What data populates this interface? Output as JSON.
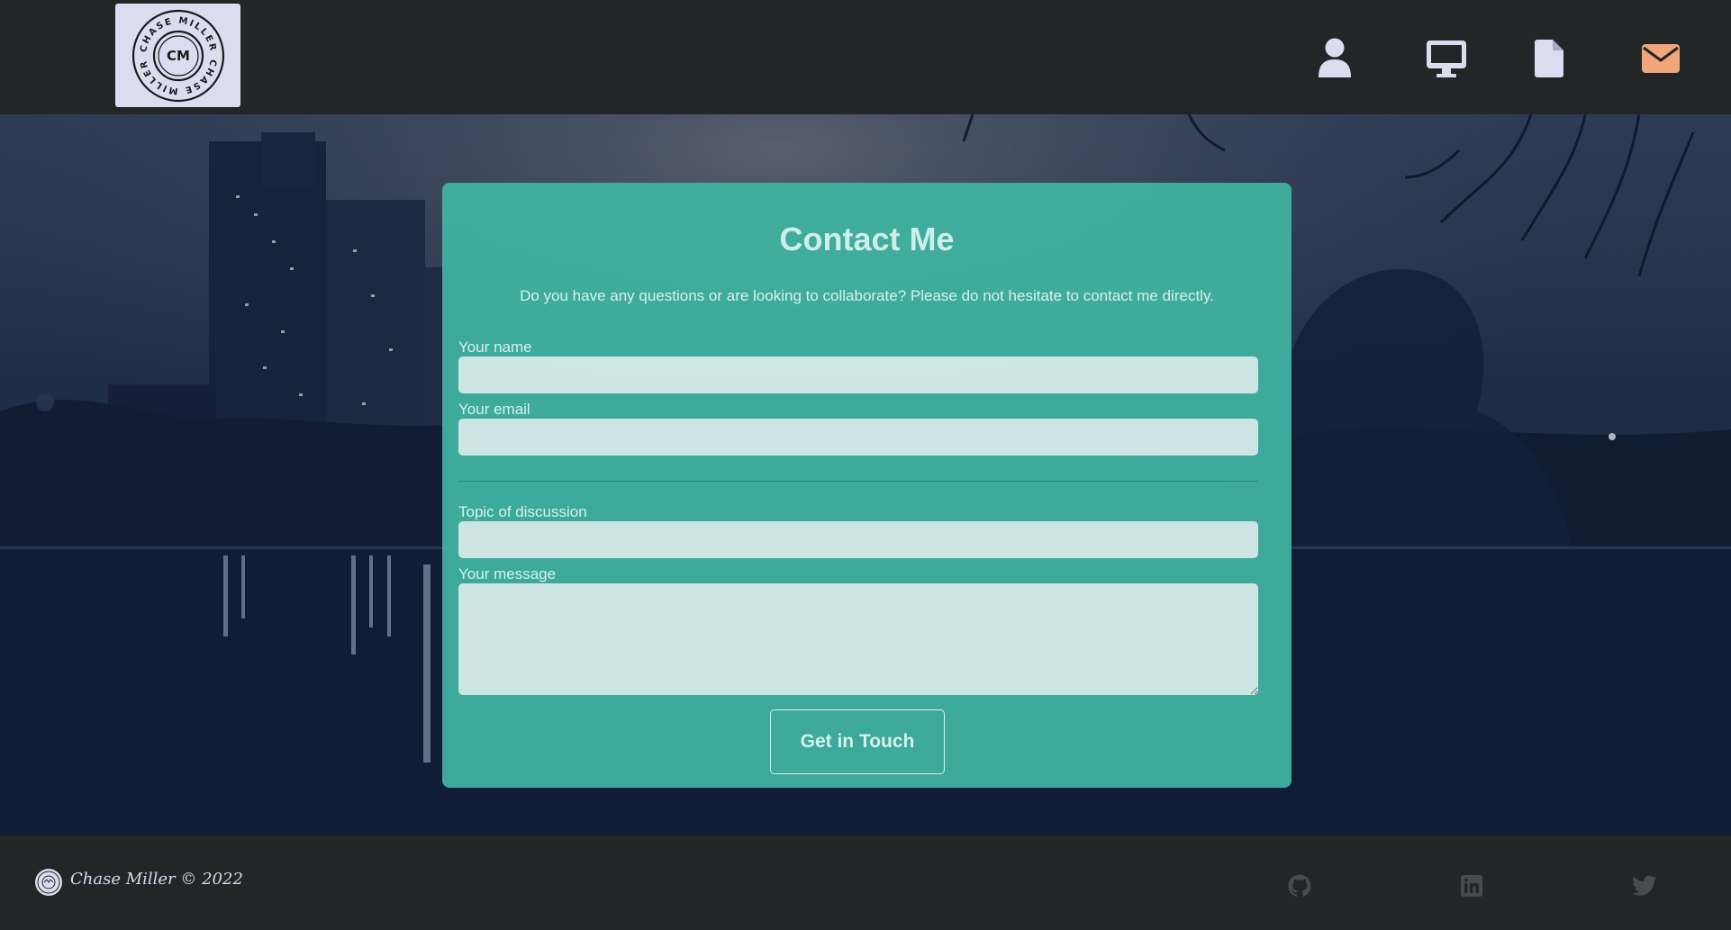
{
  "header": {
    "logo": {
      "text_top": "CHASE MILLER",
      "text_bottom": "CHASE MILLER",
      "monogram": "CM"
    },
    "nav": [
      {
        "icon": "user-icon",
        "color": "#dcdcf0"
      },
      {
        "icon": "desktop-icon",
        "color": "#dcdcf0"
      },
      {
        "icon": "file-icon",
        "color": "#dcdcf0"
      },
      {
        "icon": "envelope-icon",
        "color": "#f0a67a"
      }
    ]
  },
  "contact": {
    "title": "Contact Me",
    "subtitle": "Do you have any questions or are looking to collaborate? Please do not hesitate to contact me directly.",
    "name_label": "Your name",
    "email_label": "Your email",
    "topic_label": "Topic of discussion",
    "message_label": "Your message",
    "name_value": "",
    "email_value": "",
    "topic_value": "",
    "message_value": "",
    "submit_label": "Get in Touch"
  },
  "footer": {
    "copyright": "Chase Miller © 2022",
    "social": [
      "github-icon",
      "linkedin-icon",
      "twitter-icon"
    ]
  },
  "colors": {
    "background": "#242526",
    "card": "#40b4a2",
    "accent": "#f0a67a",
    "icon": "#dcdcf0"
  }
}
